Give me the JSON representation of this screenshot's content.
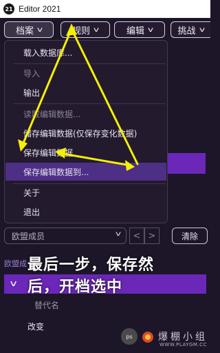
{
  "window": {
    "logo": "21",
    "title": "Editor 2021"
  },
  "menubar": {
    "items": [
      {
        "label": "档案"
      },
      {
        "label": "规则"
      },
      {
        "label": "编辑"
      },
      {
        "label": "挑战"
      }
    ]
  },
  "file_menu": {
    "items": [
      {
        "label": "载入数据库..."
      },
      {
        "label": "导入"
      },
      {
        "label": "输出"
      },
      {
        "label": "读取编辑数据..."
      },
      {
        "label": "储存编辑数据(仅保存变化数据)"
      },
      {
        "label": "保存编辑数据"
      },
      {
        "label": "保存编辑数据到..."
      },
      {
        "label": "关于"
      },
      {
        "label": "退出"
      }
    ]
  },
  "search": {
    "value": "欧盟成员",
    "prev": "<",
    "next": ">",
    "clear_label": "清除"
  },
  "list": {
    "section_label": "欧盟成",
    "alias_label": "替代名",
    "change_label": "改变"
  },
  "overlay": {
    "line1": "最后一步，保存然",
    "line2": "后，开档选中"
  },
  "watermark": {
    "badge": "ps",
    "text": "爆棚小组",
    "url": "WWW.PLAYGM.CC"
  },
  "colors": {
    "highlight": "#4d2f86",
    "selected": "#6a27b8",
    "arrow": "#f5f000"
  },
  "icons": {
    "dropdown": "chevron-down-icon",
    "logo": "app-logo-icon"
  }
}
